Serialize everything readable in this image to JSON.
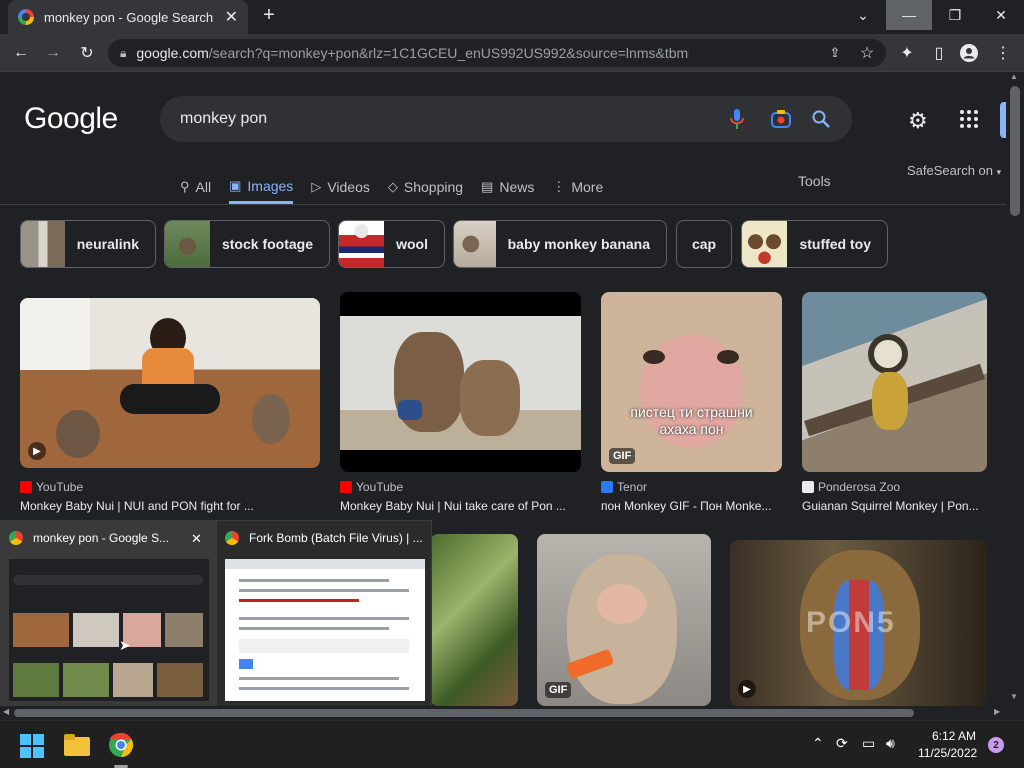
{
  "browser": {
    "tab_title": "monkey pon - Google Search",
    "url_host": "google.com",
    "url_path": "/search?q=monkey+pon&rlz=1C1GCEU_enUS992US992&source=lnms&tbm=isch&sa=X&ved..."
  },
  "search": {
    "logo": "Google",
    "query": "monkey pon",
    "tabs": [
      {
        "label": "All",
        "icon": "search-icon"
      },
      {
        "label": "Images",
        "icon": "images-icon"
      },
      {
        "label": "Videos",
        "icon": "videos-icon"
      },
      {
        "label": "Shopping",
        "icon": "tag-icon"
      },
      {
        "label": "News",
        "icon": "news-icon"
      },
      {
        "label": "More",
        "icon": "more-icon"
      }
    ],
    "tools": "Tools",
    "safesearch": "SafeSearch on"
  },
  "chips": [
    {
      "label": "neuralink"
    },
    {
      "label": "stock footage"
    },
    {
      "label": "wool"
    },
    {
      "label": "baby monkey banana"
    },
    {
      "label": "cap"
    },
    {
      "label": "stuffed toy"
    }
  ],
  "results": [
    {
      "source": "YouTube",
      "caption": "Monkey Baby Nui | NUI and PON fight for ...",
      "badge": "play"
    },
    {
      "source": "YouTube",
      "caption": "Monkey Baby Nui | Nui take care of Pon ...",
      "badge": ""
    },
    {
      "source": "Tenor",
      "caption": "пон Monkey GIF - Пон Monke...",
      "badge": "GIF",
      "overlay_text": "пистец ти страшни\nахаха пон"
    },
    {
      "source": "Ponderosa Zoo",
      "caption": "Guianan Squirrel Monkey | Pon...",
      "badge": ""
    }
  ],
  "row2": [
    {
      "badge": "GIF"
    },
    {
      "badge": "play",
      "watermark": "PON5"
    }
  ],
  "taskbar_preview": [
    {
      "title": "monkey pon - Google S..."
    },
    {
      "title": "Fork Bomb (Batch File Virus) | ..."
    }
  ],
  "tray": {
    "time": "6:12 AM",
    "date": "11/25/2022",
    "notifications": "2"
  },
  "colors": {
    "accent": "#8ab4f8",
    "background": "#202124",
    "surface": "#303134"
  }
}
